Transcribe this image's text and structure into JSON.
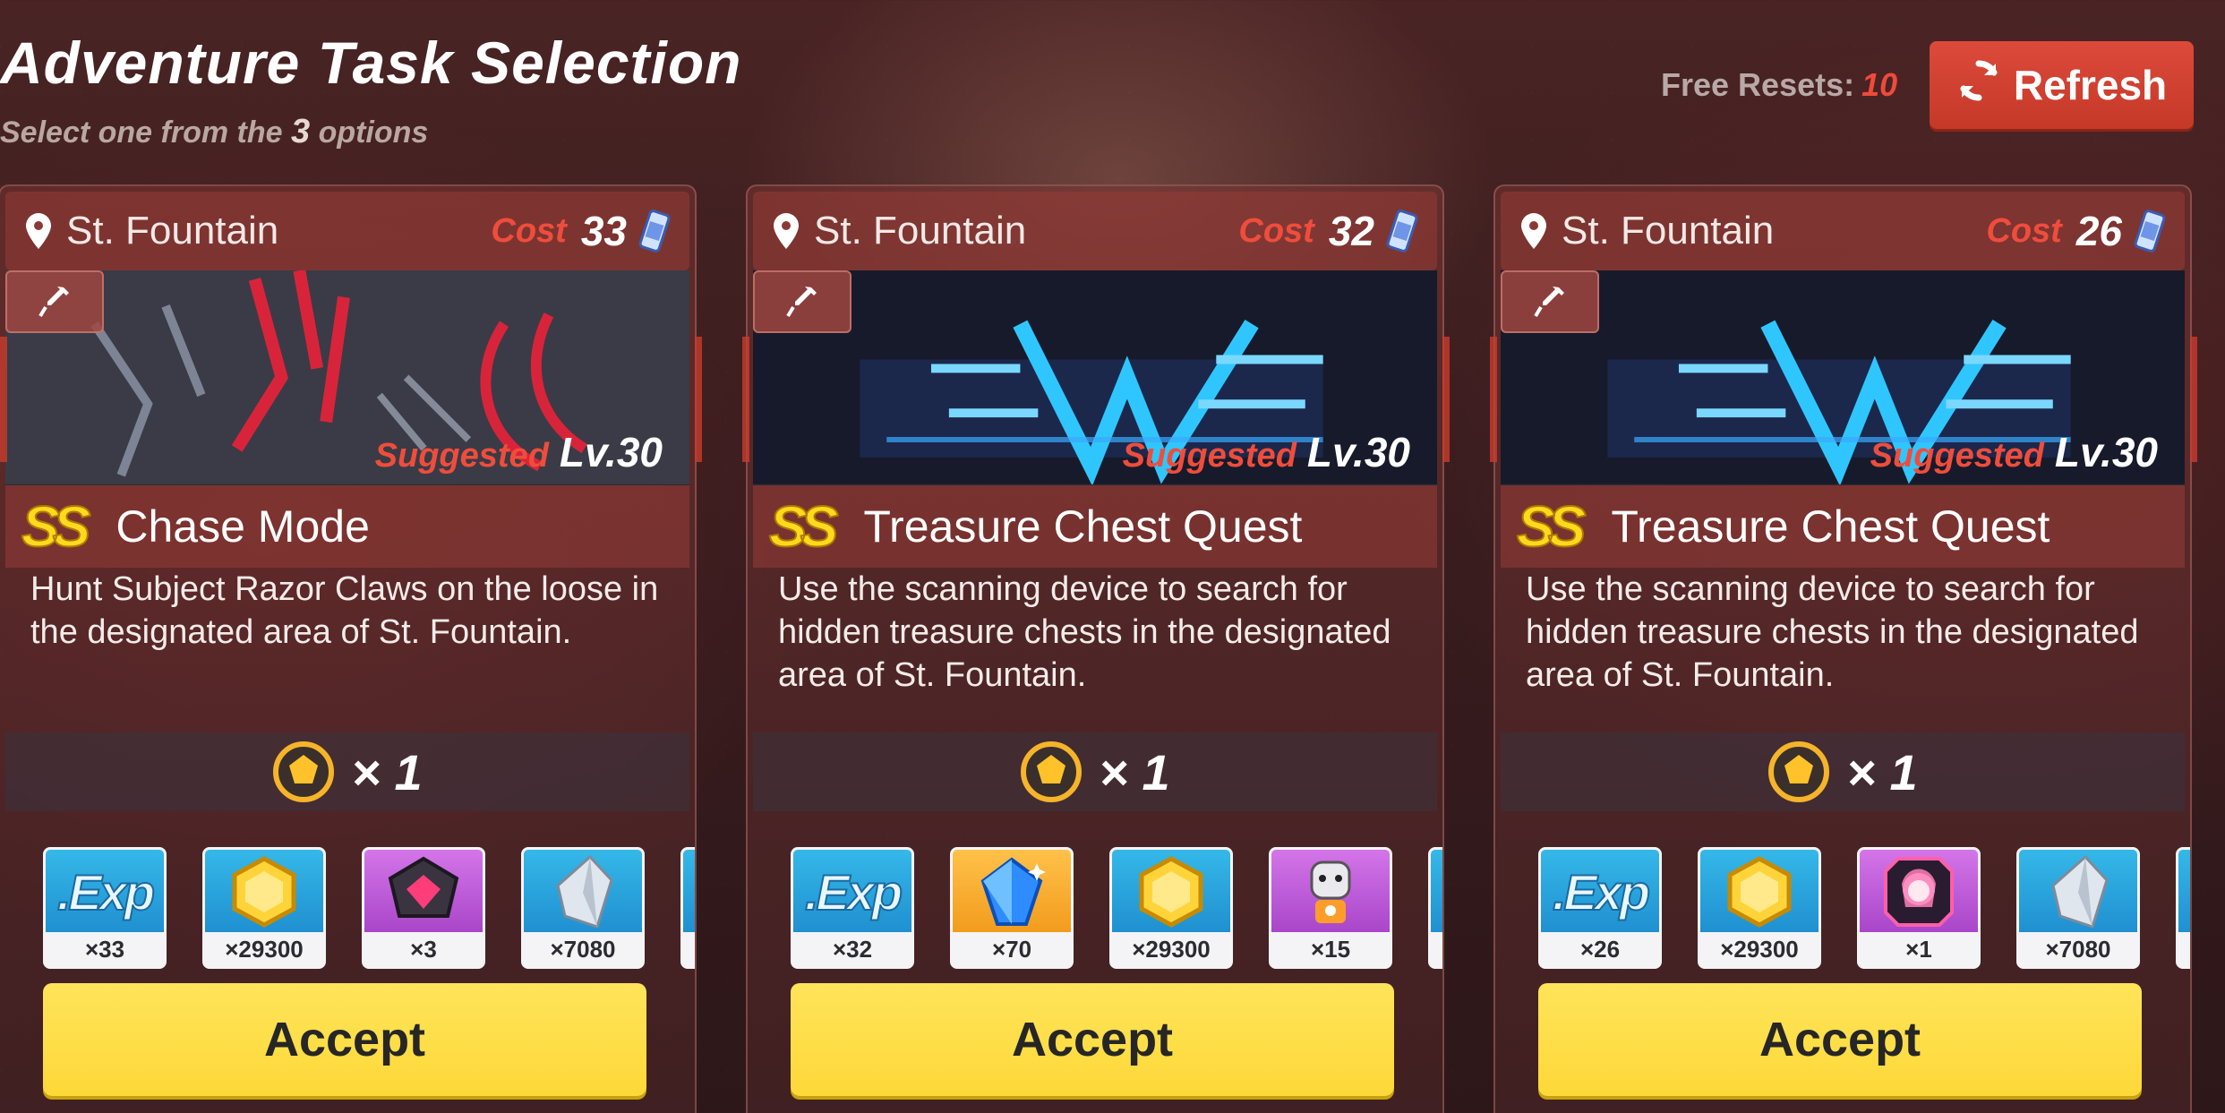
{
  "header": {
    "title": "Adventure Task Selection",
    "subtitle_pre": "Select one from the",
    "subtitle_num": "3",
    "subtitle_post": "options",
    "free_resets_label": "Free Resets:",
    "free_resets_value": "10",
    "refresh_label": "Refresh"
  },
  "colors": {
    "accent_red": "#dc4a3b",
    "accept_yellow": "#fdd838",
    "rank_yellow": "#ffd91e"
  },
  "cards": [
    {
      "location": "St. Fountain",
      "cost_label": "Cost",
      "cost": "33",
      "suggested_label": "Suggested",
      "suggested_level": "Lv.30",
      "rank": "SS",
      "mode": "Chase Mode",
      "description": "Hunt Subject Razor Claws on the loose in the designated area of St. Fountain.",
      "reward_qty": "× 1",
      "items": [
        {
          "icon": "exp-icon",
          "count": "×33"
        },
        {
          "icon": "gold-coin-icon",
          "count": "×29300"
        },
        {
          "icon": "purple-chip-icon",
          "count": "×3"
        },
        {
          "icon": "crystal-shard-icon",
          "count": "×7080"
        }
      ],
      "accept_label": "Accept"
    },
    {
      "location": "St. Fountain",
      "cost_label": "Cost",
      "cost": "32",
      "suggested_label": "Suggested",
      "suggested_level": "Lv.30",
      "rank": "SS",
      "mode": "Treasure Chest Quest",
      "description": "Use the scanning device to search for hidden treasure chests in the designated area of St. Fountain.",
      "reward_qty": "× 1",
      "items": [
        {
          "icon": "exp-icon",
          "count": "×32"
        },
        {
          "icon": "blue-crystal-icon",
          "count": "×70"
        },
        {
          "icon": "gold-coin-icon",
          "count": "×29300"
        },
        {
          "icon": "mecha-figure-icon",
          "count": "×15"
        }
      ],
      "accept_label": "Accept"
    },
    {
      "location": "St. Fountain",
      "cost_label": "Cost",
      "cost": "26",
      "suggested_label": "Suggested",
      "suggested_level": "Lv.30",
      "rank": "SS",
      "mode": "Treasure Chest Quest",
      "description": "Use the scanning device to search for hidden treasure chests in the designated area of St. Fountain.",
      "reward_qty": "× 1",
      "items": [
        {
          "icon": "exp-icon",
          "count": "×26"
        },
        {
          "icon": "gold-coin-icon",
          "count": "×29300"
        },
        {
          "icon": "character-portrait-icon",
          "count": "×1"
        },
        {
          "icon": "crystal-shard-icon",
          "count": "×7080"
        }
      ],
      "accept_label": "Accept"
    }
  ]
}
